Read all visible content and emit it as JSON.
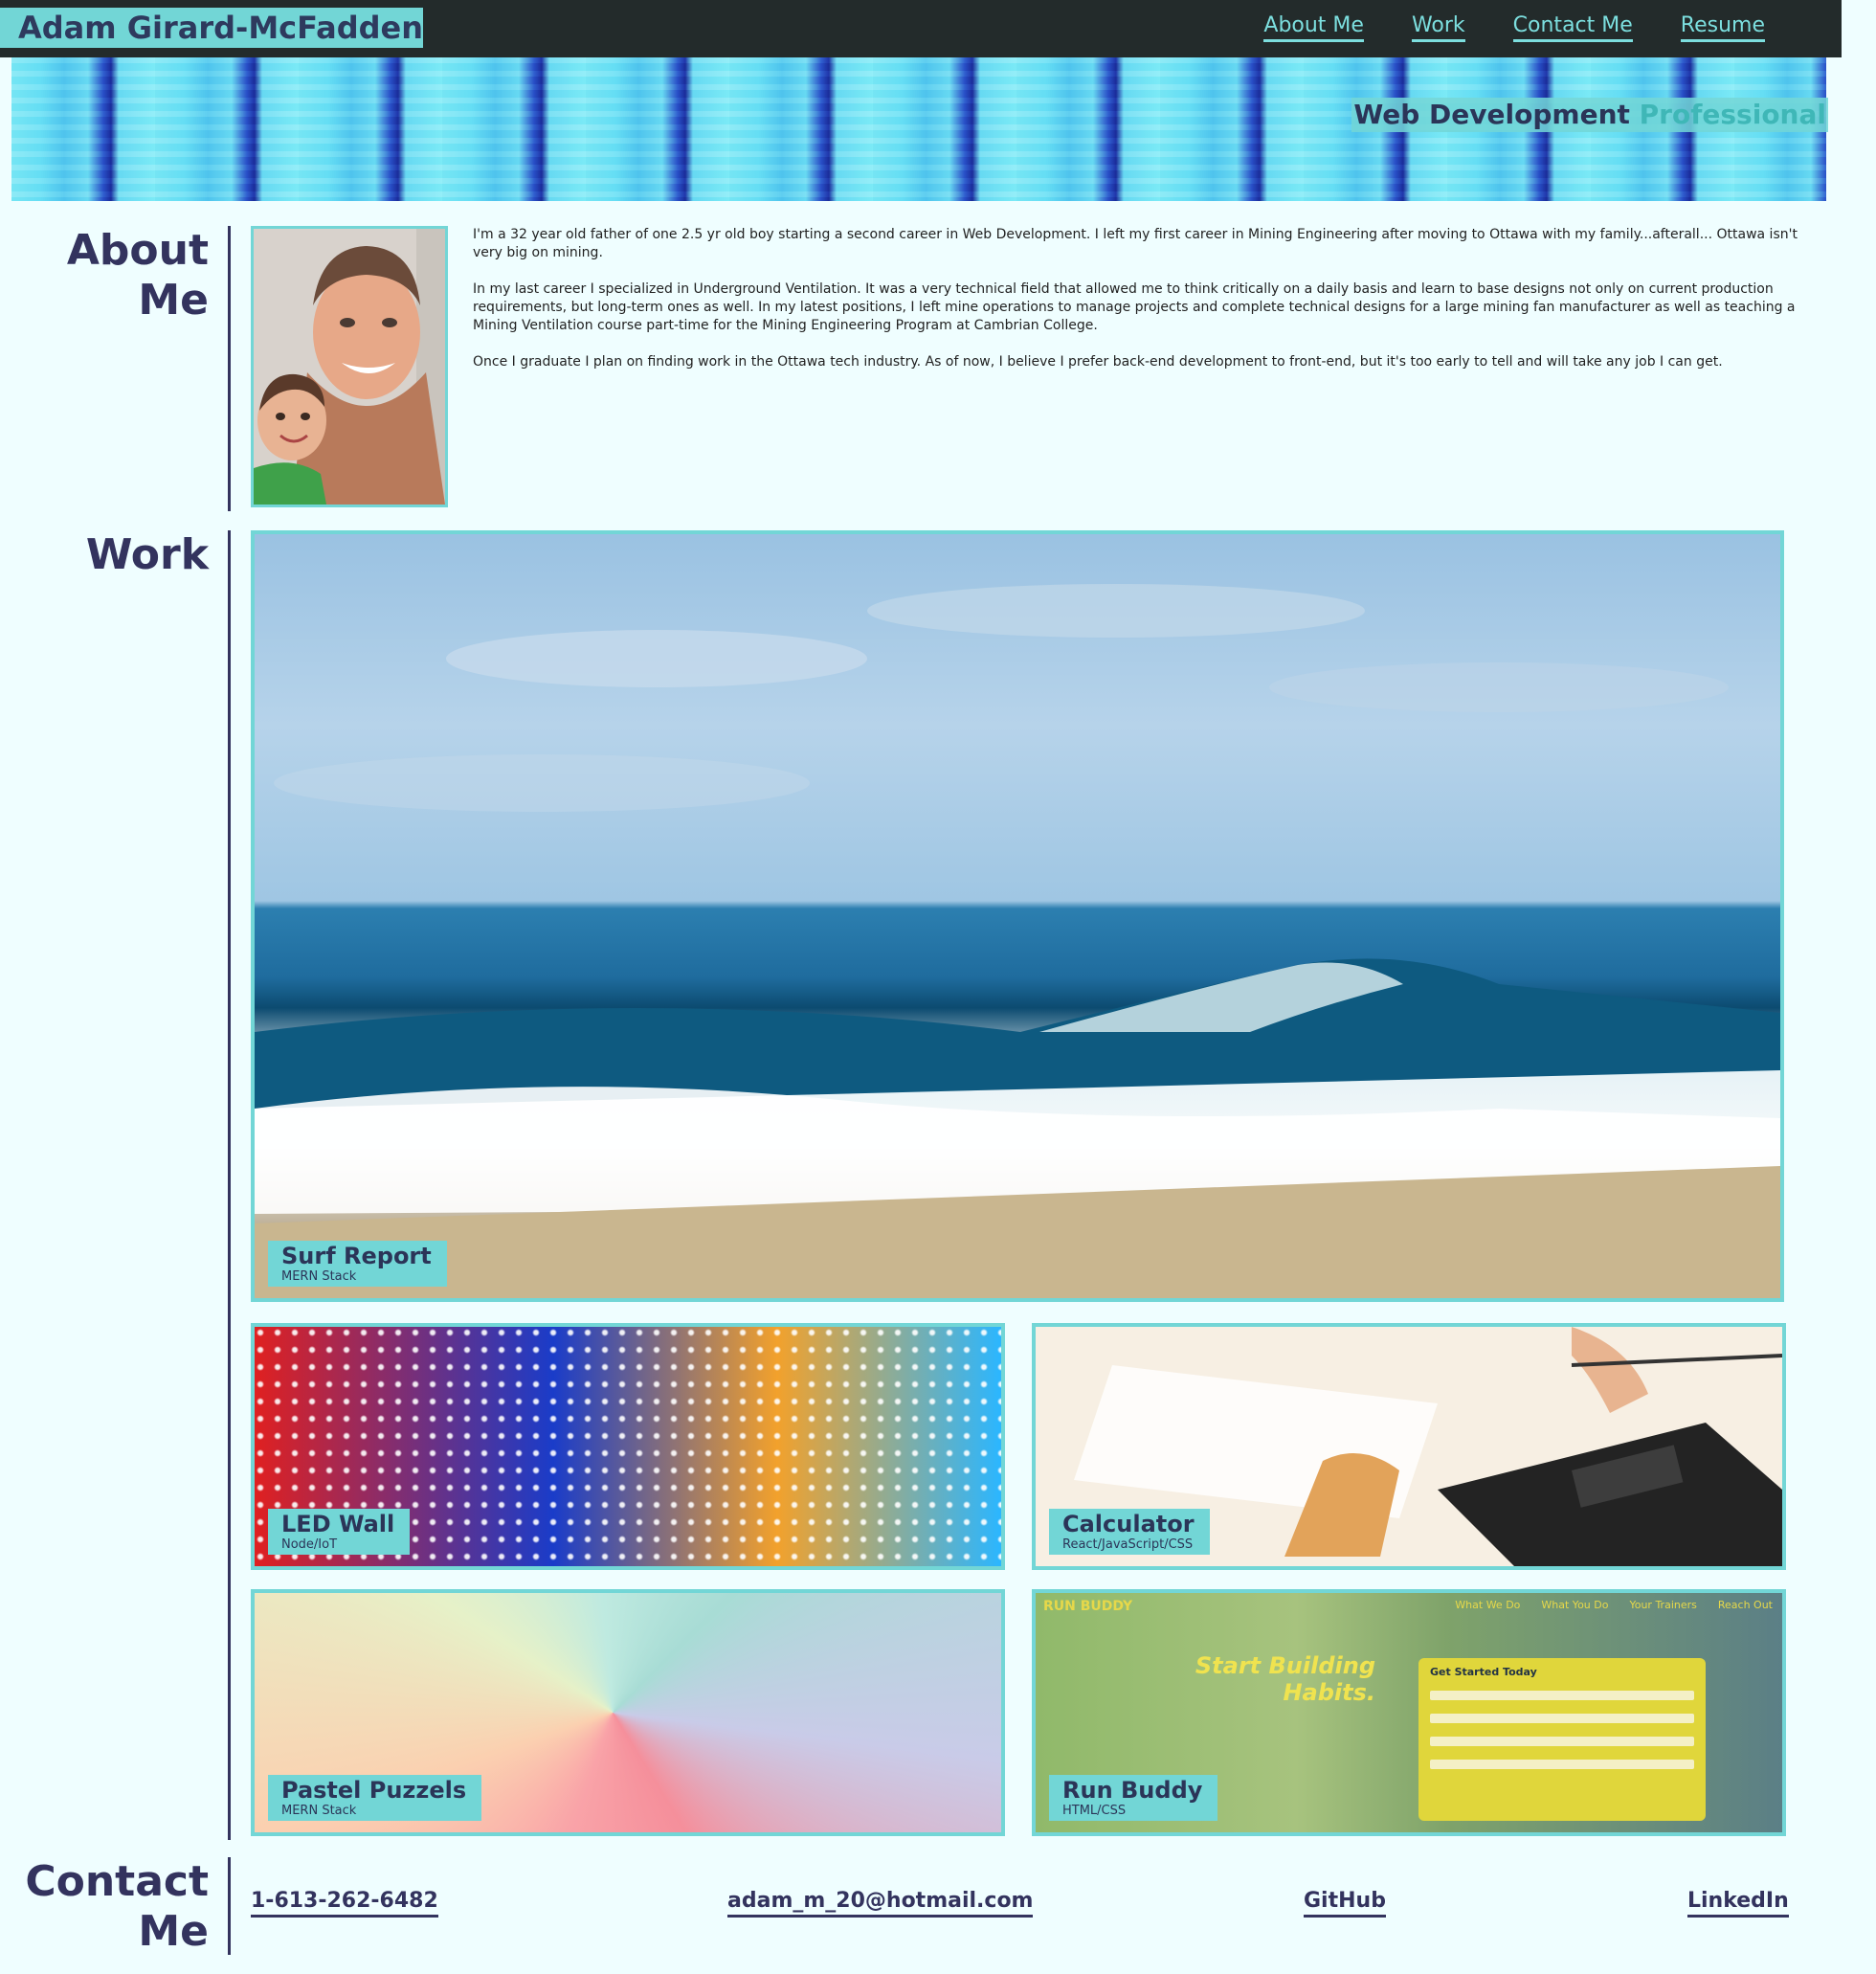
{
  "header": {
    "brand": "Adam Girard-McFadden",
    "nav": [
      "About Me",
      "Work",
      "Contact Me",
      "Resume"
    ]
  },
  "hero": {
    "tagline_main": "Web Development",
    "tagline_accent": "Professional"
  },
  "about": {
    "title_line1": "About",
    "title_line2": "Me",
    "paragraphs": [
      "I'm a 32 year old father of one 2.5 yr old boy starting a second career in Web Development. I left my first career in Mining Engineering after moving to Ottawa with my family...afterall... Ottawa isn't very big on mining.",
      "In my last career I specialized in Underground Ventilation. It was a very technical field that allowed me to think critically on a daily basis and learn to base designs not only on current production requirements, but long-term ones as well. In my latest positions, I left mine operations to manage projects and complete technical designs for a large mining fan manufacturer as well as teaching a Mining Ventilation course part-time for the Mining Engineering Program at Cambrian College.",
      "Once I graduate I plan on finding work in the Ottawa tech industry. As of now, I believe I prefer back-end development to front-end, but it's too early to tell and will take any job I can get."
    ]
  },
  "work": {
    "title": "Work",
    "projects": [
      {
        "name": "Surf Report",
        "stack": "MERN Stack"
      },
      {
        "name": "LED Wall",
        "stack": "Node/IoT"
      },
      {
        "name": "Calculator",
        "stack": "React/JavaScript/CSS"
      },
      {
        "name": "Pastel Puzzels",
        "stack": "MERN Stack"
      },
      {
        "name": "Run Buddy",
        "stack": "HTML/CSS"
      }
    ],
    "run_buddy_preview": {
      "logo": "RUN BUDDY",
      "nav": [
        "What We Do",
        "What You Do",
        "Your Trainers",
        "Reach Out"
      ],
      "heading": "Start Building Habits.",
      "form_title": "Get Started Today"
    }
  },
  "contact": {
    "title_line1": "Contact",
    "title_line2": "Me",
    "phone": "1-613-262-6482",
    "email": "adam_m_20@hotmail.com",
    "github": "GitHub",
    "linkedin": "LinkedIn"
  },
  "colors": {
    "accent": "#72d6d6",
    "navy": "#33335e",
    "header_bg": "#232b2b",
    "page_bg": "#effeff"
  }
}
